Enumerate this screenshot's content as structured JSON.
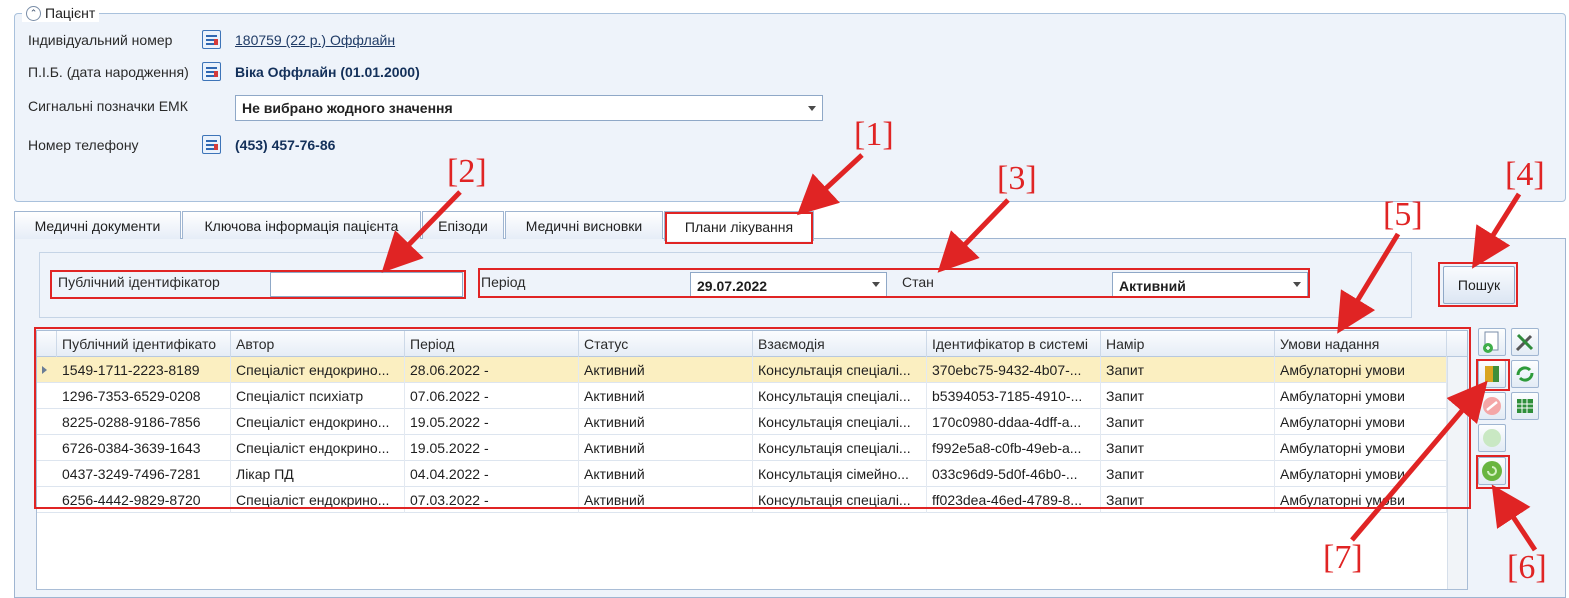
{
  "patient": {
    "legend": "Пацієнт",
    "id_label": "Індивідуальний номер",
    "id_value": "180759 (22 р.) Оффлайн",
    "name_label": "П.І.Б. (дата народження)",
    "name_value": "Віка Оффлайн (01.01.2000)",
    "emk_label": "Сигнальні позначки ЕМК",
    "emk_value": "Не вибрано жодного значення",
    "phone_label": "Номер телефону",
    "phone_value": "(453) 457-76-86"
  },
  "tabs": [
    {
      "label": "Медичні документи"
    },
    {
      "label": "Ключова інформація пацієнта"
    },
    {
      "label": "Епізоди"
    },
    {
      "label": "Медичні висновки"
    },
    {
      "label": "Плани лікування"
    }
  ],
  "filters": {
    "public_id_label": "Публічний ідентифікатор",
    "public_id_value": "",
    "period_label": "Період",
    "period_value": "29.07.2022",
    "state_label": "Стан",
    "state_value": "Активний",
    "search_label": "Пошук"
  },
  "grid": {
    "columns": [
      "Публічний ідентифікато",
      "Автор",
      "Період",
      "Статус",
      "Взаємодія",
      "Ідентифікатор в системі",
      "Намір",
      "Умови надання"
    ],
    "rows": [
      [
        "1549-1711-2223-8189",
        "Спеціаліст ендокрино...",
        "28.06.2022 -",
        "Активний",
        "Консультація спеціалі...",
        "370ebc75-9432-4b07-...",
        "Запит",
        "Амбулаторні умови"
      ],
      [
        "1296-7353-6529-0208",
        "Спеціаліст психіатр",
        "07.06.2022 -",
        "Активний",
        "Консультація спеціалі...",
        "b5394053-7185-4910-...",
        "Запит",
        "Амбулаторні умови"
      ],
      [
        "8225-0288-9186-7856",
        "Спеціаліст ендокрино...",
        "19.05.2022 -",
        "Активний",
        "Консультація спеціалі...",
        "170c0980-ddaa-4dff-a...",
        "Запит",
        "Амбулаторні умови"
      ],
      [
        "6726-0384-3639-1643",
        "Спеціаліст ендокрино...",
        "19.05.2022 -",
        "Активний",
        "Консультація спеціалі...",
        "f992e5a8-c0fb-49eb-a...",
        "Запит",
        "Амбулаторні умови"
      ],
      [
        "0437-3249-7496-7281",
        "Лікар ПД",
        "04.04.2022 -",
        "Активний",
        "Консультація сімейно...",
        "033c96d9-5d0f-46b0-...",
        "Запит",
        "Амбулаторні умови"
      ],
      [
        "6256-4442-9829-8720",
        "Спеціаліст ендокрино...",
        "07.03.2022 -",
        "Активний",
        "Консультація спеціалі...",
        "ff023dea-46ed-4789-8...",
        "Запит",
        "Амбулаторні умови"
      ]
    ]
  },
  "side_buttons": [
    "new-document-icon",
    "tools-icon",
    "book-icon",
    "refresh-arrows-icon",
    "cancel-icon",
    "table-icon",
    "disabled-action-icon",
    "green-action-icon"
  ],
  "annotations": [
    "[1]",
    "[2]",
    "[3]",
    "[4]",
    "[5]",
    "[6]",
    "[7]"
  ],
  "colors": {
    "annotation": "#e02424",
    "selected_row": "#fbefc1",
    "panel": "#eef3fa"
  }
}
